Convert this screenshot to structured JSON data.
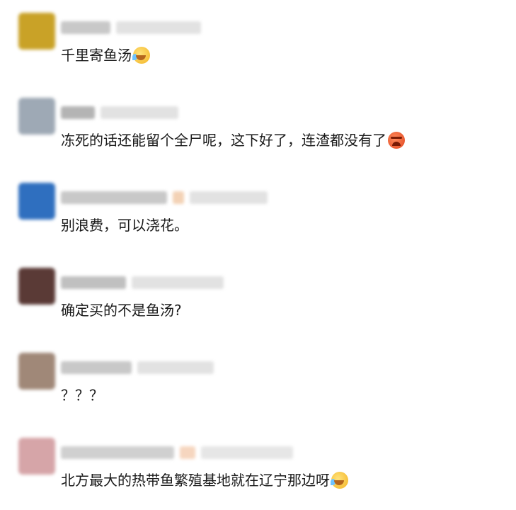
{
  "comments": [
    {
      "text": "千里寄鱼汤",
      "emoji": "laughing-with-tears-emoji",
      "avatar_color": "#c9a227"
    },
    {
      "text": "冻死的话还能留个全尸呢，这下好了，连渣都没有了",
      "emoji": "angry-emoji",
      "avatar_color": "#9ea9b5"
    },
    {
      "text": "别浪费，可以浇花。",
      "emoji": "",
      "avatar_color": "#2f6fbf"
    },
    {
      "text": "确定买的不是鱼汤?",
      "emoji": "",
      "avatar_color": "#5a3a36"
    },
    {
      "text": "？？？",
      "emoji": "",
      "avatar_color": "#a08878"
    },
    {
      "text": "北方最大的热带鱼繁殖基地就在辽宁那边呀",
      "emoji": "laughing-with-tears-emoji",
      "avatar_color": "#d6a5a8"
    }
  ]
}
